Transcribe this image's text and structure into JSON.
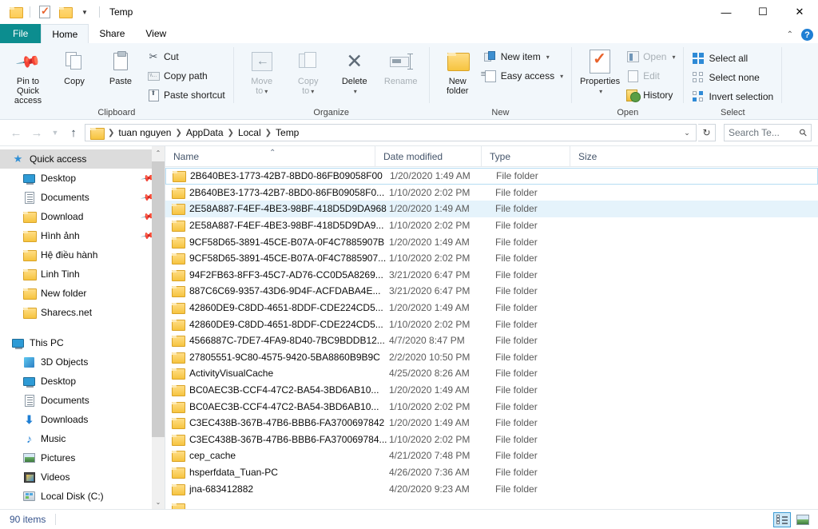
{
  "window": {
    "title": "Temp",
    "quick_access_icons": [
      "folder-icon",
      "properties-check-icon",
      "new-folder-icon"
    ],
    "controls": {
      "minimize": "—",
      "maximize": "☐",
      "close": "✕"
    }
  },
  "ribbon": {
    "tabs": [
      {
        "label": "File",
        "kind": "file"
      },
      {
        "label": "Home",
        "kind": "active"
      },
      {
        "label": "Share",
        "kind": "normal"
      },
      {
        "label": "View",
        "kind": "normal"
      }
    ],
    "collapse_icon": "chevron-up-icon",
    "help_icon": "help-icon",
    "groups": [
      {
        "name": "Clipboard",
        "big": [
          {
            "label": "Pin to Quick\naccess",
            "line1": "Pin to Quick",
            "line2": "access",
            "icon": "pin-icon",
            "disabled": false
          },
          {
            "label": "Copy",
            "line1": "Copy",
            "line2": "",
            "icon": "copy-icon",
            "disabled": false
          },
          {
            "label": "Paste",
            "line1": "Paste",
            "line2": "",
            "icon": "paste-icon",
            "disabled": false
          }
        ],
        "small": [
          {
            "label": "Cut",
            "icon": "scissors-icon"
          },
          {
            "label": "Copy path",
            "icon": "copy-path-icon"
          },
          {
            "label": "Paste shortcut",
            "icon": "paste-shortcut-icon"
          }
        ]
      },
      {
        "name": "Organize",
        "big": [
          {
            "line1": "Move",
            "line2": "to",
            "icon": "move-to-icon",
            "disabled": true,
            "caret": true
          },
          {
            "line1": "Copy",
            "line2": "to",
            "icon": "copy-to-icon",
            "disabled": true,
            "caret": true
          },
          {
            "line1": "Delete",
            "line2": "",
            "icon": "delete-icon",
            "disabled": false,
            "caret": true
          },
          {
            "line1": "Rename",
            "line2": "",
            "icon": "rename-icon",
            "disabled": true,
            "caret": false
          }
        ]
      },
      {
        "name": "New",
        "big": [
          {
            "line1": "New",
            "line2": "folder",
            "icon": "new-folder-icon",
            "disabled": false
          }
        ],
        "small": [
          {
            "label": "New item",
            "icon": "new-item-icon",
            "caret": true
          },
          {
            "label": "Easy access",
            "icon": "easy-access-icon",
            "caret": true
          }
        ]
      },
      {
        "name": "Open",
        "big": [
          {
            "line1": "Properties",
            "line2": "",
            "icon": "properties-icon",
            "disabled": false,
            "caret": true
          }
        ],
        "small": [
          {
            "label": "Open",
            "icon": "open-icon",
            "caret": true,
            "disabled": true
          },
          {
            "label": "Edit",
            "icon": "edit-icon",
            "disabled": true
          },
          {
            "label": "History",
            "icon": "history-icon",
            "disabled": false
          }
        ]
      },
      {
        "name": "Select",
        "small": [
          {
            "label": "Select all",
            "icon": "select-all-icon"
          },
          {
            "label": "Select none",
            "icon": "select-none-icon"
          },
          {
            "label": "Invert selection",
            "icon": "invert-selection-icon"
          }
        ]
      }
    ]
  },
  "addressbar": {
    "back_icon": "arrow-left-icon",
    "forward_icon": "arrow-right-icon",
    "recent_icon": "chevron-down-icon",
    "up_icon": "arrow-up-icon",
    "breadcrumbs": [
      "tuan nguyen",
      "AppData",
      "Local",
      "Temp"
    ],
    "dropdown_icon": "chevron-down-icon",
    "refresh_icon": "refresh-icon",
    "search": {
      "placeholder": "Search Te...",
      "value": "",
      "icon": "search-icon"
    }
  },
  "sidebar": {
    "items": [
      {
        "label": "Quick access",
        "icon": "star-pin-icon",
        "level": 1,
        "selected": true,
        "pinned": false
      },
      {
        "label": "Desktop",
        "icon": "monitor-icon",
        "level": 2,
        "pinned": true
      },
      {
        "label": "Documents",
        "icon": "document-icon",
        "level": 2,
        "pinned": true
      },
      {
        "label": "Download",
        "icon": "folder-icon",
        "level": 2,
        "pinned": true
      },
      {
        "label": "Hình ảnh",
        "icon": "folder-icon",
        "level": 2,
        "pinned": true
      },
      {
        "label": "Hệ điều hành",
        "icon": "folder-icon",
        "level": 2,
        "pinned": false
      },
      {
        "label": "Linh Tinh",
        "icon": "folder-icon",
        "level": 2,
        "pinned": false
      },
      {
        "label": "New folder",
        "icon": "folder-icon",
        "level": 2,
        "pinned": false
      },
      {
        "label": "Sharecs.net",
        "icon": "folder-icon",
        "level": 2,
        "pinned": false
      },
      {
        "label": "",
        "icon": "spacer",
        "level": 1,
        "spacer": true
      },
      {
        "label": "This PC",
        "icon": "pc-icon",
        "level": 1,
        "pinned": false
      },
      {
        "label": "3D Objects",
        "icon": "3d-objects-icon",
        "level": 2,
        "pinned": false
      },
      {
        "label": "Desktop",
        "icon": "monitor-icon",
        "level": 2,
        "pinned": false
      },
      {
        "label": "Documents",
        "icon": "document-icon",
        "level": 2,
        "pinned": false
      },
      {
        "label": "Downloads",
        "icon": "downloads-arrow-icon",
        "level": 2,
        "pinned": false
      },
      {
        "label": "Music",
        "icon": "music-note-icon",
        "level": 2,
        "pinned": false
      },
      {
        "label": "Pictures",
        "icon": "pictures-icon",
        "level": 2,
        "pinned": false
      },
      {
        "label": "Videos",
        "icon": "videos-icon",
        "level": 2,
        "pinned": false
      },
      {
        "label": "Local Disk (C:)",
        "icon": "disk-icon",
        "level": 2,
        "pinned": false
      }
    ],
    "scroll_up_icon": "chevron-up-icon",
    "scroll_down_icon": "chevron-down-icon"
  },
  "filelist": {
    "columns": [
      {
        "label": "Name",
        "key": "name"
      },
      {
        "label": "Date modified",
        "key": "date"
      },
      {
        "label": "Type",
        "key": "type"
      },
      {
        "label": "Size",
        "key": "size"
      }
    ],
    "sort": {
      "column": "Name",
      "direction": "asc",
      "marker": "⌃"
    },
    "rows": [
      {
        "name": "2B640BE3-1773-42B7-8BD0-86FB09058F00",
        "date": "1/20/2020 1:49 AM",
        "type": "File folder",
        "size": "",
        "state": "focus"
      },
      {
        "name": "2B640BE3-1773-42B7-8BD0-86FB09058F0...",
        "date": "1/10/2020 2:02 PM",
        "type": "File folder",
        "size": "",
        "state": ""
      },
      {
        "name": "2E58A887-F4EF-4BE3-98BF-418D5D9DA968",
        "date": "1/20/2020 1:49 AM",
        "type": "File folder",
        "size": "",
        "state": "hover"
      },
      {
        "name": "2E58A887-F4EF-4BE3-98BF-418D5D9DA9...",
        "date": "1/10/2020 2:02 PM",
        "type": "File folder",
        "size": "",
        "state": ""
      },
      {
        "name": "9CF58D65-3891-45CE-B07A-0F4C7885907B",
        "date": "1/20/2020 1:49 AM",
        "type": "File folder",
        "size": "",
        "state": ""
      },
      {
        "name": "9CF58D65-3891-45CE-B07A-0F4C7885907...",
        "date": "1/10/2020 2:02 PM",
        "type": "File folder",
        "size": "",
        "state": ""
      },
      {
        "name": "94F2FB63-8FF3-45C7-AD76-CC0D5A8269...",
        "date": "3/21/2020 6:47 PM",
        "type": "File folder",
        "size": "",
        "state": ""
      },
      {
        "name": "887C6C69-9357-43D6-9D4F-ACFDABA4E...",
        "date": "3/21/2020 6:47 PM",
        "type": "File folder",
        "size": "",
        "state": ""
      },
      {
        "name": "42860DE9-C8DD-4651-8DDF-CDE224CD5...",
        "date": "1/20/2020 1:49 AM",
        "type": "File folder",
        "size": "",
        "state": ""
      },
      {
        "name": "42860DE9-C8DD-4651-8DDF-CDE224CD5...",
        "date": "1/10/2020 2:02 PM",
        "type": "File folder",
        "size": "",
        "state": ""
      },
      {
        "name": "4566887C-7DE7-4FA9-8D40-7BC9BDDB12...",
        "date": "4/7/2020 8:47 PM",
        "type": "File folder",
        "size": "",
        "state": ""
      },
      {
        "name": "27805551-9C80-4575-9420-5BA8860B9B9C",
        "date": "2/2/2020 10:50 PM",
        "type": "File folder",
        "size": "",
        "state": ""
      },
      {
        "name": "ActivityVisualCache",
        "date": "4/25/2020 8:26 AM",
        "type": "File folder",
        "size": "",
        "state": ""
      },
      {
        "name": "BC0AEC3B-CCF4-47C2-BA54-3BD6AB10...",
        "date": "1/20/2020 1:49 AM",
        "type": "File folder",
        "size": "",
        "state": ""
      },
      {
        "name": "BC0AEC3B-CCF4-47C2-BA54-3BD6AB10...",
        "date": "1/10/2020 2:02 PM",
        "type": "File folder",
        "size": "",
        "state": ""
      },
      {
        "name": "C3EC438B-367B-47B6-BBB6-FA3700697842",
        "date": "1/20/2020 1:49 AM",
        "type": "File folder",
        "size": "",
        "state": ""
      },
      {
        "name": "C3EC438B-367B-47B6-BBB6-FA370069784...",
        "date": "1/10/2020 2:02 PM",
        "type": "File folder",
        "size": "",
        "state": ""
      },
      {
        "name": "cep_cache",
        "date": "4/21/2020 7:48 PM",
        "type": "File folder",
        "size": "",
        "state": ""
      },
      {
        "name": "hsperfdata_Tuan-PC",
        "date": "4/26/2020 7:36 AM",
        "type": "File folder",
        "size": "",
        "state": ""
      },
      {
        "name": "jna-683412882",
        "date": "4/20/2020 9:23 AM",
        "type": "File folder",
        "size": "",
        "state": ""
      },
      {
        "name": "",
        "date": "",
        "type": "",
        "size": "",
        "state": "partial"
      }
    ]
  },
  "statusbar": {
    "item_count": "90 items",
    "views": [
      {
        "name": "details-view",
        "active": true
      },
      {
        "name": "large-icons-view",
        "active": false
      }
    ]
  },
  "colors": {
    "accent_teal": "#0c8d8f",
    "ribbon_bg": "#f2f7fb",
    "selection_blue": "#e5f3fb",
    "focus_border": "#b6dcf2",
    "nav_selected": "#dcdcdc",
    "status_text": "#36538c"
  }
}
